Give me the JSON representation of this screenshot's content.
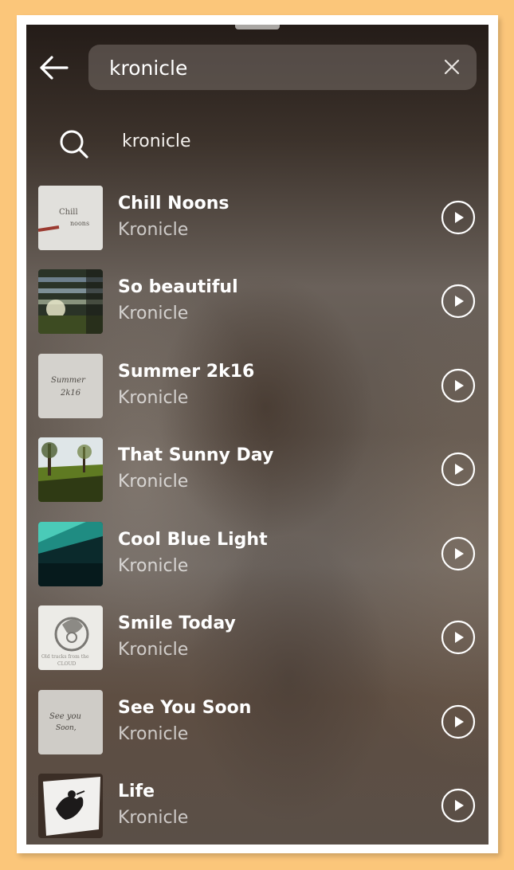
{
  "search": {
    "query": "kronicle"
  },
  "suggestion": {
    "text": "kronicle"
  },
  "results": [
    {
      "title": "Chill Noons",
      "artist": "Kronicle",
      "thumbnail": "handwritten-note"
    },
    {
      "title": "So beautiful",
      "artist": "Kronicle",
      "thumbnail": "sunlit-window"
    },
    {
      "title": "Summer 2k16",
      "artist": "Kronicle",
      "thumbnail": "handwritten-note"
    },
    {
      "title": "That Sunny Day",
      "artist": "Kronicle",
      "thumbnail": "park-trees"
    },
    {
      "title": "Cool Blue Light",
      "artist": "Kronicle",
      "thumbnail": "teal-light"
    },
    {
      "title": "Smile Today",
      "artist": "Kronicle",
      "thumbnail": "logo-drawing"
    },
    {
      "title": "See You Soon",
      "artist": "Kronicle",
      "thumbnail": "handwritten-note"
    },
    {
      "title": "Life",
      "artist": "Kronicle",
      "thumbnail": "bird-drawing"
    }
  ],
  "thumb_text": {
    "chill": "Chill",
    "noons": "noons",
    "summer": "Summer",
    "k16": "2k16",
    "cloud_line": "Old tracks from the",
    "cloud": "CLOUD",
    "see_you": "See you",
    "soon": "Soon,"
  },
  "colors": {
    "page_background": "#fbc67a",
    "text_primary": "#ffffff",
    "text_secondary": "#b8b3ae"
  }
}
